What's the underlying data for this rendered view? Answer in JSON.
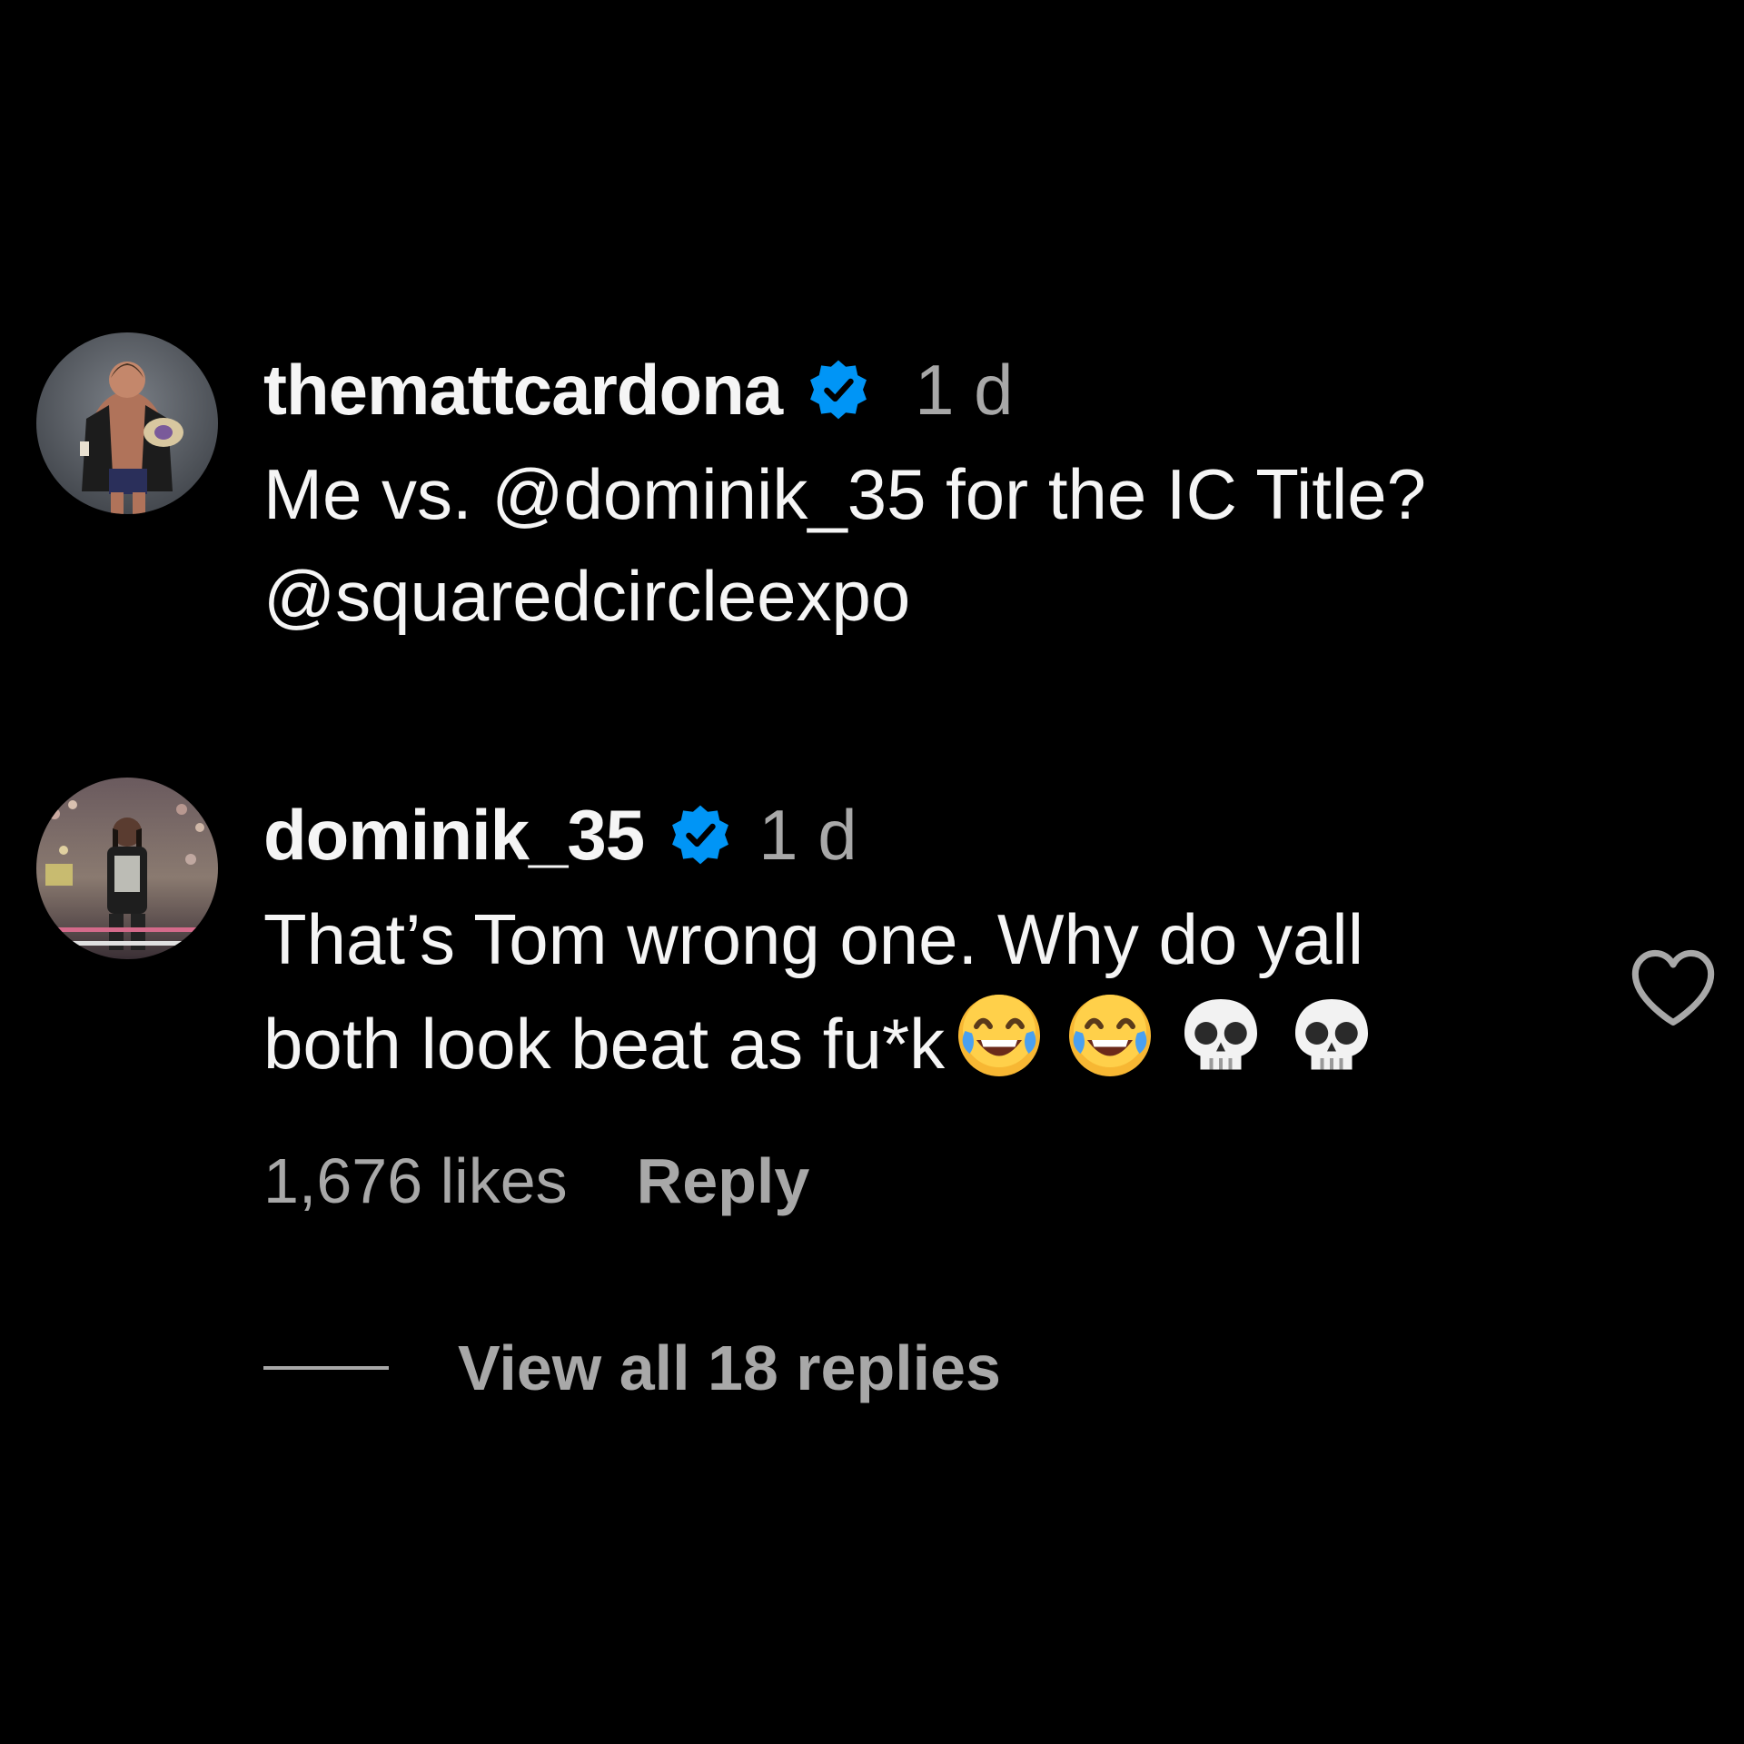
{
  "comments": [
    {
      "username": "themattcardona",
      "verified": true,
      "time": "1 d",
      "lines": [
        "Me vs. @dominik_35 for the IC Title?",
        "@squaredcircleexpo"
      ],
      "avatar_icon": "wrestler-with-belt-avatar"
    },
    {
      "username": "dominik_35",
      "verified": true,
      "time": "1 d",
      "lines": [
        "That’s Tom wrong one. Why do yall",
        "both look beat as fu*k"
      ],
      "emojis": [
        "face-with-tears-of-joy-icon",
        "face-with-tears-of-joy-icon",
        "skull-icon",
        "skull-icon"
      ],
      "likes": "1,676 likes",
      "reply_label": "Reply",
      "avatar_icon": "wrestler-in-arena-avatar"
    }
  ],
  "view_replies_label": "View all 18 replies",
  "colors": {
    "background": "#000000",
    "primary_text": "#f5f5f5",
    "secondary_text": "#a8a8a8",
    "verified_blue": "#0095f6"
  }
}
